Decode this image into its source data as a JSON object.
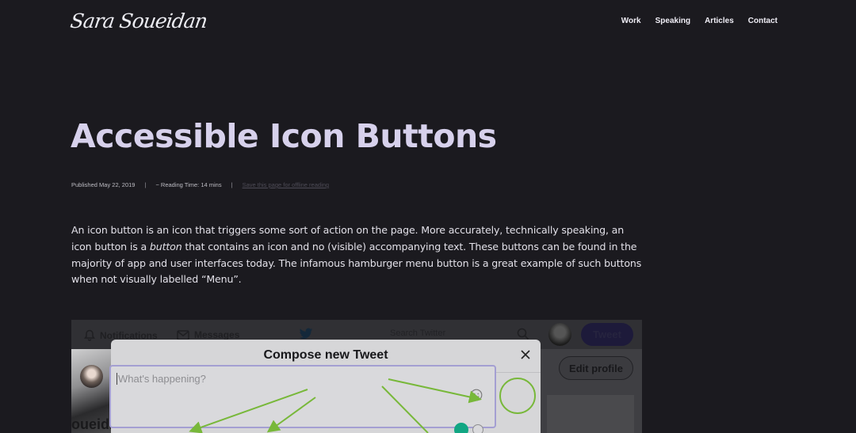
{
  "header": {
    "logo_text": "Sara Soueidan",
    "nav": [
      {
        "label": "Work"
      },
      {
        "label": "Speaking"
      },
      {
        "label": "Articles"
      },
      {
        "label": "Contact"
      }
    ]
  },
  "article": {
    "title": "Accessible Icon Buttons",
    "meta": {
      "published": "Published May 22, 2019",
      "separator": "|",
      "reading_time": "~ Reading Time: 14 mins",
      "save_link": "Save this page for offline reading"
    },
    "intro_parts": {
      "before": "An icon button is an icon that triggers some sort of action on the page. More accurately, technically speaking, an icon button is a ",
      "emphasis": "button",
      "after": " that contains an icon and no (visible) accompanying text. These buttons can be found in the majority of app and user interfaces today. The infamous hamburger menu button is a great example of such buttons when not visually labelled “Menu”."
    }
  },
  "figure": {
    "twitter": {
      "notifications": "Notifications",
      "messages": "Messages",
      "search_placeholder": "Search Twitter",
      "tweet_button": "Tweet",
      "edit_profile": "Edit profile",
      "profile_name_fragment": "oueida"
    },
    "modal": {
      "title": "Compose new Tweet",
      "input_placeholder": "What's happening?"
    },
    "colors": {
      "annotation": "#78b83a",
      "page_bg": "#1b1a1f",
      "title": "#d7d1ec"
    }
  }
}
